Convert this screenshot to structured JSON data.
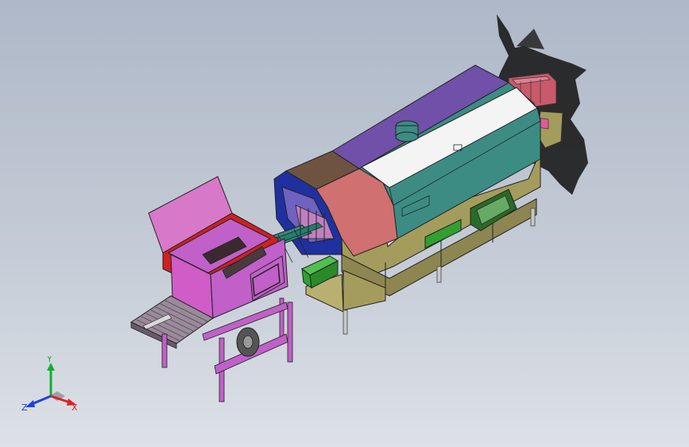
{
  "axes": {
    "x_label": "X",
    "y_label": "Y",
    "z_label": "Z",
    "x_color": "#e02020",
    "y_color": "#10b030",
    "z_color": "#2040e0"
  },
  "colors": {
    "background_top": "#aeb8c8",
    "background_bottom": "#dde1e7",
    "body_olive": "#a49c5c",
    "hood_purple": "#7050a8",
    "hood_teal": "#3c8c84",
    "hood_white": "#f4f4f4",
    "front_brown": "#6e5440",
    "front_salmon": "#d07070",
    "entry_blue": "#2030a0",
    "feeder_pink": "#c060c8",
    "feeder_lid": "#d878c8",
    "feeder_red": "#d02020",
    "green_box": "#30a030",
    "smoke": "#202020"
  }
}
